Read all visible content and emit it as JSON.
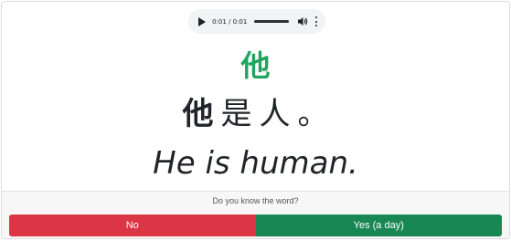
{
  "audio": {
    "time": "0:01 / 0:01",
    "progress_fraction": 1.0
  },
  "card": {
    "target_word": "他",
    "sentence_tokens": [
      {
        "text": "他",
        "highlighted": true
      },
      {
        "text": "是",
        "highlighted": false
      },
      {
        "text": "人",
        "highlighted": false
      },
      {
        "text": "。",
        "highlighted": false
      }
    ],
    "translation": "He is human."
  },
  "footer": {
    "question": "Do you know the word?",
    "no_label": "No",
    "yes_label": "Yes (a day)"
  },
  "colors": {
    "target_word": "#22a35f",
    "no_button": "#dc3545",
    "yes_button": "#198754"
  },
  "icons": {
    "play": "play-icon",
    "volume": "volume-icon",
    "more": "more-vertical-icon"
  }
}
